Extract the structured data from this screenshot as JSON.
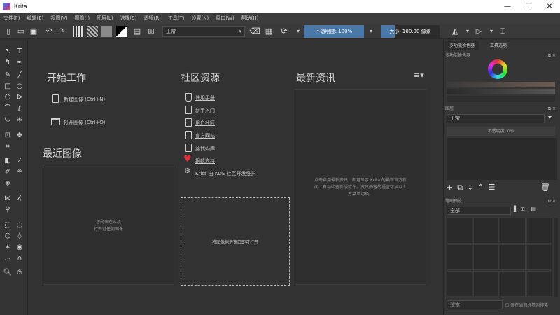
{
  "window": {
    "title": "Krita",
    "min": "—",
    "max": "☐",
    "close": "✕"
  },
  "menu": [
    "文件(F)",
    "编辑(E)",
    "视图(V)",
    "图像(I)",
    "图层(L)",
    "选择(S)",
    "滤镜(R)",
    "工具(T)",
    "设置(N)",
    "窗口(W)",
    "帮助(H)"
  ],
  "toolbar": {
    "blend_mode": "正常",
    "opacity_label": "不透明度: 100%",
    "size_label": "大小: 100.00 像素"
  },
  "welcome": {
    "start_title": "开始工作",
    "new_image": "新建图像",
    "new_shortcut": "(Ctrl+N)",
    "open_image": "打开图像",
    "open_shortcut": "(Ctrl+O)",
    "recent_title": "最近图像",
    "recent_empty_1": "您尚未在本机",
    "recent_empty_2": "打开过任何图像",
    "community_title": "社区资源",
    "community_links": [
      "使用手册",
      "新手入门",
      "用户社区",
      "官方网站",
      "源代码库",
      "捐款支持"
    ],
    "kde_link": "Krita 由 KDE 社区开发维护",
    "dropzone": "将图像拖进窗口即可打开",
    "news_title": "最新资讯",
    "news_text_1": "点击启用最新资讯，即可显示 Krita 的最新官方新",
    "news_text_2": "闻、自动检查新版软件。资讯内容的语言可从以上",
    "news_text_3": "方菜单切换。",
    "news_menu": "≡"
  },
  "dock": {
    "tab1": "多功能拾色器",
    "tab2": "工具选项",
    "color_header": "多功能拾色器",
    "layers_header": "图层",
    "layers_mode": "正常",
    "layers_opacity": "不透明度: 0%",
    "brush_header": "笔刷预设",
    "brush_tag": "全部",
    "brush_search": "搜索",
    "brush_filter": "仅在当前标签内搜索"
  },
  "colors": {
    "accent": "#4a78a8",
    "heart": "#e0303a"
  }
}
